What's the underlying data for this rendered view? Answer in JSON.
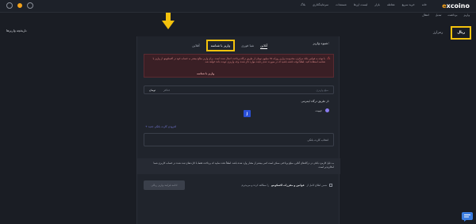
{
  "header": {
    "logo_prefix": "e",
    "logo_word": "xcoino",
    "nav": [
      "خانه",
      "خرید سریع",
      "معامله",
      "بازار",
      "لیست ارزها",
      "مستندات",
      "سرمایه‌گذاری",
      "بلاگ"
    ]
  },
  "subnav": [
    "واریز",
    "برداشت",
    "تبدیل",
    "انتقال"
  ],
  "wallet": {
    "title": "تاریخچه واریزها",
    "tab_rial": "ریال",
    "tab_crypto": "رمزارز"
  },
  "panel": {
    "header": "شیوه واریز:",
    "tabs": {
      "online": "آنلاین",
      "id_deposit": "واریز با شناسه",
      "offline": "آفلاین",
      "sheba": "شبا فوری"
    },
    "warning": {
      "text": "با توجه به قوانین بانک مرکزی، محدودیت واریز روزانه ۲۵ میلیون تومان از طریق درگاه پرداخت اعمال شده است. برای واریز مبالغ بیشتر به حساب خود در اکسکوینو، از واریز با شناسه استفاده کنید. لطفاً توجه داشته باشید که در صورت عدم رعایت موارد ذکر شده، وجه واریزی عودت داده خواهد شد.",
      "link": "واریز با شناسه"
    },
    "amount": {
      "placeholder": "مبلغ واریزی",
      "unit": "تومان",
      "max": "حداکثر"
    },
    "gateway_label": "از طریق درگاه اینترنتی:",
    "gateway_name": "جیبیت",
    "gateway_logo": "J",
    "card_link": "+ افزودن کارت بانکی جدید",
    "card_placeholder": "انتخاب کارت بانکی",
    "note": "به دلیل کارمزد بانکی در درگاه‌های آنلاین، مبلغ پرداختی ممکن است کمی بیشتر از مقدار وارد شده باشد. لطفاً دقت نمایید که پرداخت فقط با کارت‌های ثبت شده در حساب کاربری شما امکان‌پذیر است.",
    "terms_prefix": "ضمن اطلاع کامل از",
    "terms_link": "قوانین و مقررات اکسکوینو",
    "terms_suffix": "را مطالعه کرده و می‌پذیرم",
    "submit": "ادامه فرایند واریز ریالی"
  }
}
